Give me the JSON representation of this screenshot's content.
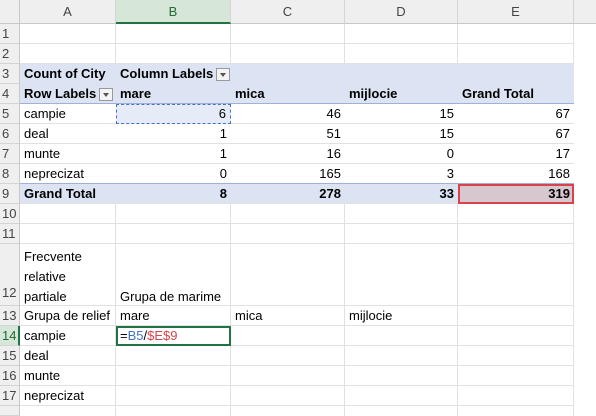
{
  "columns": [
    "A",
    "B",
    "C",
    "D",
    "E"
  ],
  "rows": [
    "1",
    "2",
    "3",
    "4",
    "5",
    "6",
    "7",
    "8",
    "9",
    "10",
    "11",
    "12",
    "13",
    "14",
    "15",
    "16",
    "17"
  ],
  "pivot": {
    "count_label": "Count of City",
    "column_labels": "Column Labels",
    "row_labels": "Row Labels",
    "headers": [
      "mare",
      "mica",
      "mijlocie",
      "Grand Total"
    ],
    "data": [
      {
        "label": "campie",
        "values": [
          "6",
          "46",
          "15",
          "67"
        ]
      },
      {
        "label": "deal",
        "values": [
          "1",
          "51",
          "15",
          "67"
        ]
      },
      {
        "label": "munte",
        "values": [
          "1",
          "16",
          "0",
          "17"
        ]
      },
      {
        "label": "neprecizat",
        "values": [
          "0",
          "165",
          "3",
          "168"
        ]
      }
    ],
    "total": {
      "label": "Grand Total",
      "values": [
        "8",
        "278",
        "33",
        "319"
      ]
    }
  },
  "table2": {
    "title_lines": [
      "Frecvente",
      "relative",
      "partiale"
    ],
    "grupa_marime": "Grupa de marime",
    "grupa_relief": "Grupa de relief",
    "cols": [
      "mare",
      "mica",
      "mijlocie"
    ],
    "rows": [
      "campie",
      "deal",
      "munte",
      "neprecizat"
    ],
    "formula_ref1": "B5",
    "formula_slash": "/",
    "formula_ref2": "$E$9",
    "formula_eq": "="
  },
  "colors": {
    "pivot_fill": "#dce3f2",
    "active": "#217346",
    "ref_blue": "#4472c4",
    "ref_red": "#d9424a"
  }
}
